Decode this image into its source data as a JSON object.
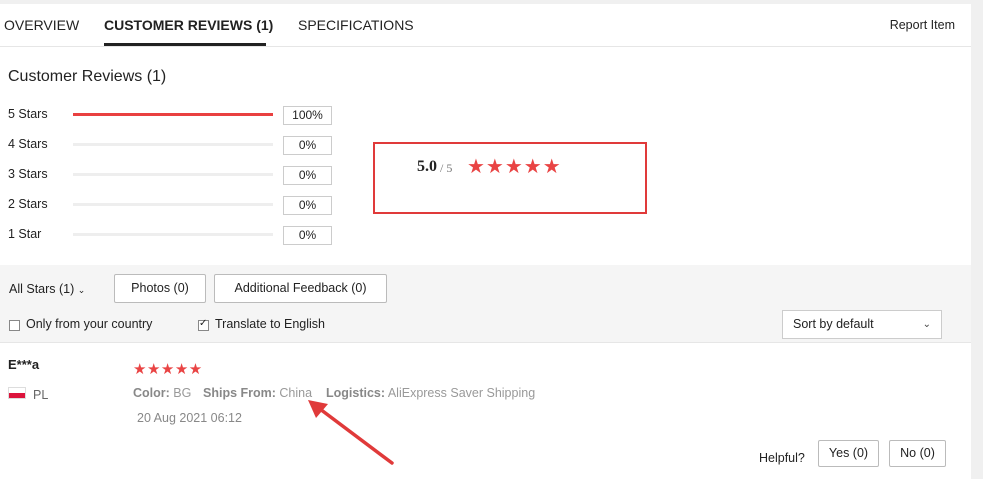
{
  "tabs": [
    {
      "label": "OVERVIEW"
    },
    {
      "label": "CUSTOMER REVIEWS (1)"
    },
    {
      "label": "SPECIFICATIONS"
    }
  ],
  "report_item": "Report Item",
  "section_title": "Customer Reviews (1)",
  "ratings": [
    {
      "label": "5 Stars",
      "pct": "100%",
      "fraction": 1.0
    },
    {
      "label": "4 Stars",
      "pct": "0%",
      "fraction": 0.0
    },
    {
      "label": "3 Stars",
      "pct": "0%",
      "fraction": 0.0
    },
    {
      "label": "2 Stars",
      "pct": "0%",
      "fraction": 0.0
    },
    {
      "label": "1 Star",
      "pct": "0%",
      "fraction": 0.0
    }
  ],
  "summary": {
    "score": "5.0",
    "out_of": "/ 5",
    "stars": "★★★★★"
  },
  "filters": {
    "all_stars": "All Stars (1)",
    "photos": "Photos (0)",
    "additional_feedback": "Additional Feedback (0)",
    "only_country": "Only from your country",
    "translate": "Translate to English",
    "sort": "Sort by default"
  },
  "review": {
    "name": "E***a",
    "country": "PL",
    "stars": "★★★★★",
    "color_label": "Color:",
    "color_value": "BG",
    "ships_label": "Ships From:",
    "ships_value": "China",
    "logistics_label": "Logistics:",
    "logistics_value": "AliExpress Saver Shipping",
    "date": "20 Aug 2021 06:12",
    "helpful": "Helpful?",
    "yes": "Yes (0)",
    "no": "No (0)"
  },
  "colors": {
    "accent": "#e94040",
    "highlight_box": "#e03a3a"
  }
}
